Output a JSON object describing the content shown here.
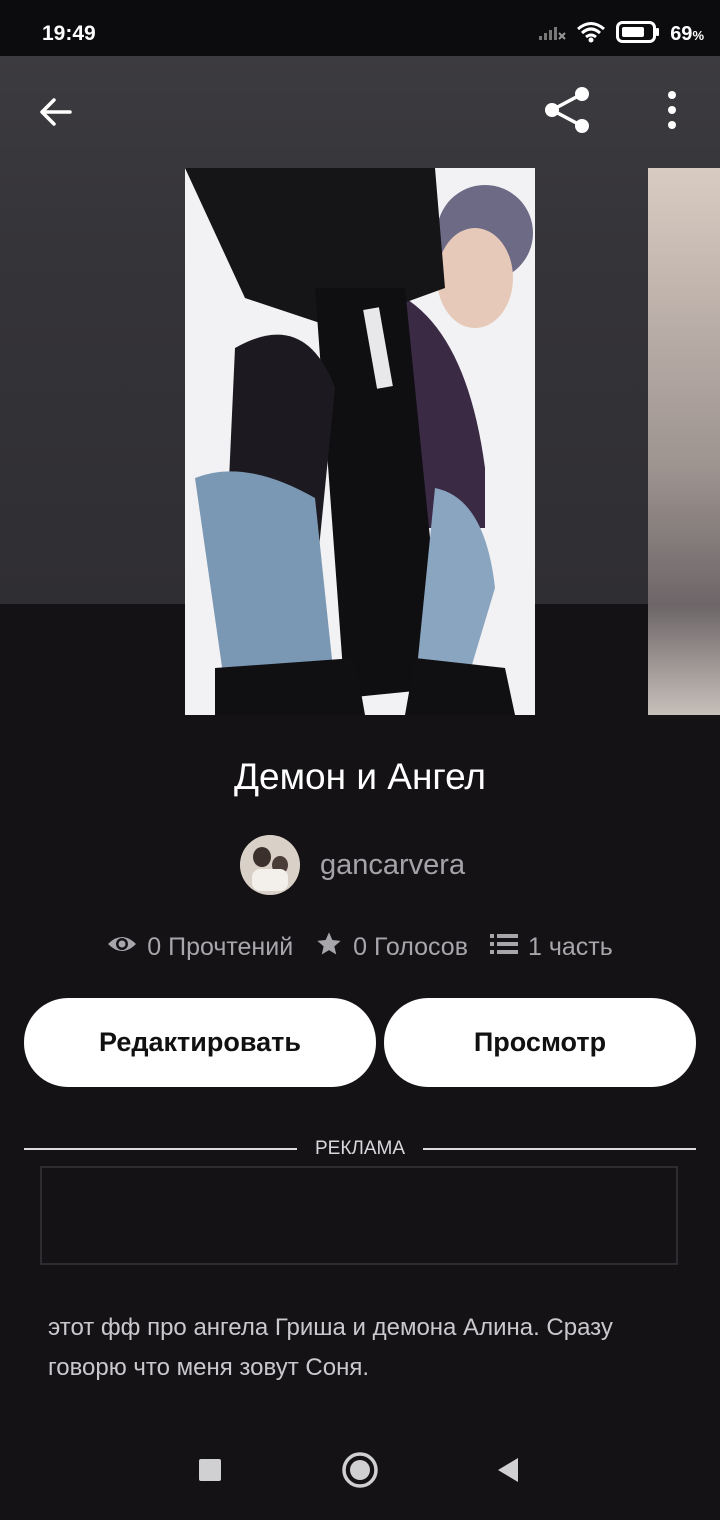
{
  "status_bar": {
    "time": "19:49",
    "battery_percent": "69",
    "battery_unit": "%"
  },
  "story": {
    "title": "Демон и Ангел",
    "author": "gancarvera",
    "stats": {
      "reads": "0 Прочтений",
      "votes": "0 Голосов",
      "parts": "1 часть"
    },
    "description": "этот фф про ангела Гриша и демона Алина. Сразу говорю что меня зовут Соня."
  },
  "actions": {
    "edit_label": "Редактировать",
    "view_label": "Просмотр"
  },
  "ad": {
    "label": "РЕКЛАМА"
  },
  "icons": {
    "back": "arrow-left",
    "share": "share",
    "more": "more-vertical",
    "reads": "eye",
    "votes": "star",
    "parts": "list",
    "nav_recents": "square",
    "nav_home": "circle",
    "nav_back": "triangle-left"
  },
  "colors": {
    "background": "#141215",
    "button_bg": "#ffffff",
    "secondary_text": "#a7a6ab"
  }
}
